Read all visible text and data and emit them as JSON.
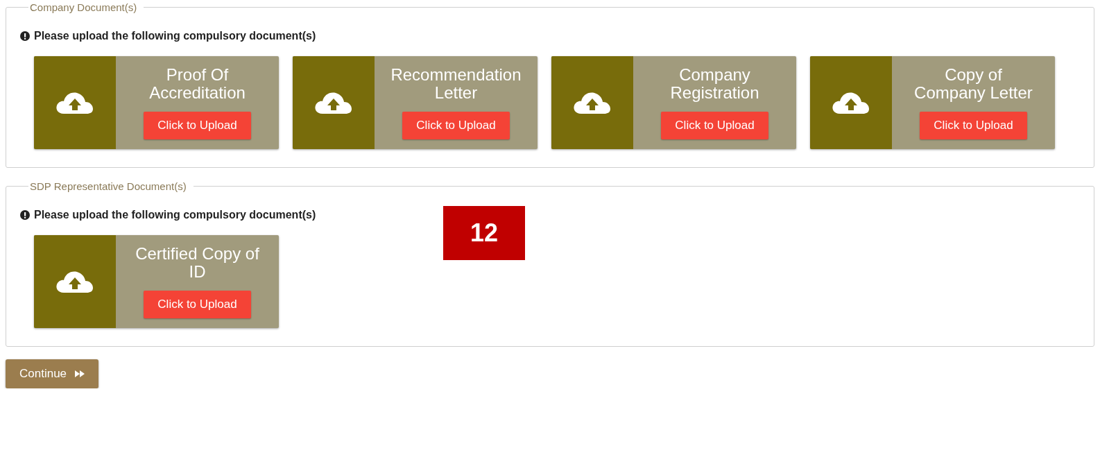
{
  "sections": [
    {
      "legend": "Company Document(s)",
      "notice": "Please upload the following compulsory document(s)",
      "documents": [
        {
          "title_lines": [
            "Proof Of",
            "Accreditation"
          ],
          "button": "Click to Upload"
        },
        {
          "title_lines": [
            "Recommendation",
            "Letter"
          ],
          "button": "Click to Upload"
        },
        {
          "title_lines": [
            "Company",
            "Registration"
          ],
          "button": "Click to Upload"
        },
        {
          "title_lines": [
            "Copy of",
            "Company Letter"
          ],
          "button": "Click to Upload"
        }
      ]
    },
    {
      "legend": "SDP Representative Document(s)",
      "notice": "Please upload the following compulsory document(s)",
      "documents": [
        {
          "title_lines": [
            "Certified Copy of",
            "ID"
          ],
          "button": "Click to Upload"
        }
      ]
    }
  ],
  "step_badge": "12",
  "continue_button": "Continue"
}
